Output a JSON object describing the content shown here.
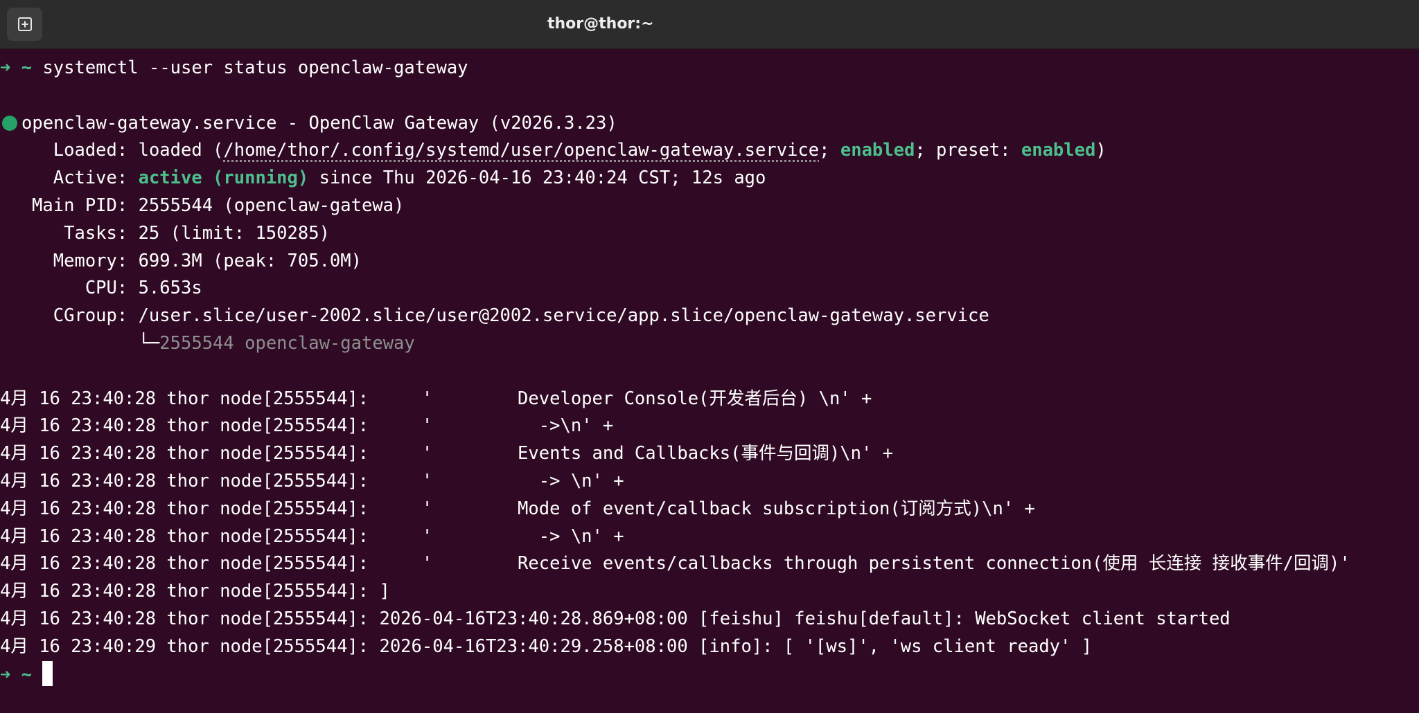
{
  "window": {
    "title": "thor@thor:~",
    "new_tab_icon": "new-tab-icon"
  },
  "prompt": {
    "arrow": "➜",
    "cwd": "~"
  },
  "command": "systemctl --user status openclaw-gateway",
  "status": {
    "service_header": "openclaw-gateway.service - OpenClaw Gateway (v2026.3.23)",
    "loaded_label": "     Loaded: ",
    "loaded_prefix": "loaded (",
    "loaded_path": "/home/thor/.config/systemd/user/openclaw-gateway.service",
    "loaded_sep1": "; ",
    "loaded_enabled": "enabled",
    "loaded_sep2": "; preset: ",
    "loaded_preset": "enabled",
    "loaded_suffix": ")",
    "active_label": "     Active: ",
    "active_state": "active (running)",
    "active_rest": " since Thu 2026-04-16 23:40:24 CST; 12s ago",
    "main_pid": "   Main PID: 2555544 (openclaw-gatewa)",
    "tasks": "      Tasks: 25 (limit: 150285)",
    "memory": "     Memory: 699.3M (peak: 705.0M)",
    "cpu": "        CPU: 5.653s",
    "cgroup": "     CGroup: /user.slice/user-2002.slice/user@2002.service/app.slice/openclaw-gateway.service",
    "cgroup_tree_branch": "             └─",
    "cgroup_tree_proc": "2555544 openclaw-gateway"
  },
  "log_lines": [
    "4月 16 23:40:28 thor node[2555544]:     '        Developer Console(开发者后台) \\n' +",
    "4月 16 23:40:28 thor node[2555544]:     '          ->\\n' +",
    "4月 16 23:40:28 thor node[2555544]:     '        Events and Callbacks(事件与回调)\\n' +",
    "4月 16 23:40:28 thor node[2555544]:     '          -> \\n' +",
    "4月 16 23:40:28 thor node[2555544]:     '        Mode of event/callback subscription(订阅方式)\\n' +",
    "4月 16 23:40:28 thor node[2555544]:     '          -> \\n' +",
    "4月 16 23:40:28 thor node[2555544]:     '        Receive events/callbacks through persistent connection(使用 长连接 接收事件/回调)'",
    "4月 16 23:40:28 thor node[2555544]: ]",
    "4月 16 23:40:28 thor node[2555544]: 2026-04-16T23:40:28.869+08:00 [feishu] feishu[default]: WebSocket client started",
    "4月 16 23:40:29 thor node[2555544]: 2026-04-16T23:40:29.258+08:00 [info]: [ '[ws]', 'ws client ready' ]"
  ],
  "colors": {
    "background": "#300a24",
    "titlebar": "#2c2c2c",
    "prompt_green": "#4cbf8c",
    "status_dot": "#26a269"
  }
}
